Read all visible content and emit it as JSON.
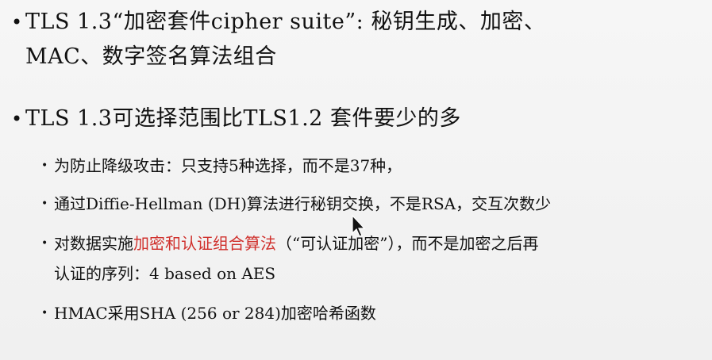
{
  "bullets": {
    "b1": {
      "line1": "TLS 1.3“加密套件cipher suite”: 秘钥生成、加密、",
      "line2": "MAC、数字签名算法组合"
    },
    "b2": "TLS 1.3可选择范围比TLS1.2 套件要少的多",
    "sub1": "为防止降级攻击：只支持5种选择，而不是37种，",
    "sub2": "通过Diffie-Hellman (DH)算法进行秘钥交换，不是RSA，交互次数少",
    "sub3": {
      "before": "对数据实施",
      "highlight": "加密和认证组合算法",
      "after": "（“可认证加密”），而不是加密之后再",
      "line2": "认证的序列：4 based on AES"
    },
    "sub4": "HMAC采用SHA (256 or 284)加密哈希函数"
  },
  "icons": {
    "bullet": "•",
    "cursor": "mouse-pointer-icon"
  },
  "colors": {
    "highlight": "#d0312d",
    "background": "#f3f3f3"
  }
}
